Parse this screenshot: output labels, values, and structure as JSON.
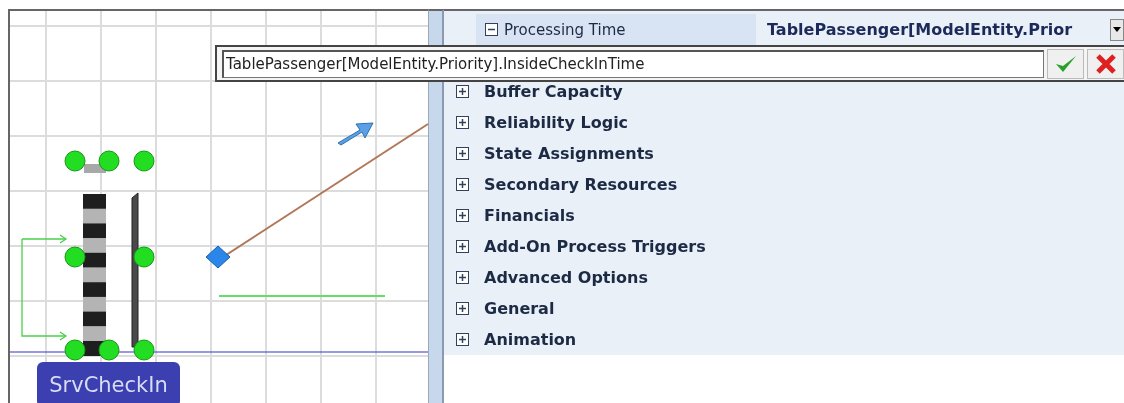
{
  "canvas": {
    "object_label": "SrvCheckIn"
  },
  "properties": {
    "property_row": {
      "label": "Processing Time",
      "expanded": true,
      "value": "TablePassenger[ModelEntity.Prior"
    },
    "categories": [
      {
        "label": "Buffer Capacity",
        "expanded": false
      },
      {
        "label": "Reliability Logic",
        "expanded": false
      },
      {
        "label": "State Assignments",
        "expanded": false
      },
      {
        "label": "Secondary Resources",
        "expanded": false
      },
      {
        "label": "Financials",
        "expanded": false
      },
      {
        "label": "Add-On Process Triggers",
        "expanded": false
      },
      {
        "label": "Advanced Options",
        "expanded": false
      },
      {
        "label": "General",
        "expanded": false
      },
      {
        "label": "Animation",
        "expanded": false
      }
    ]
  },
  "expression_editor": {
    "value": "TablePassenger[ModelEntity.Priority].InsideCheckInTime"
  }
}
